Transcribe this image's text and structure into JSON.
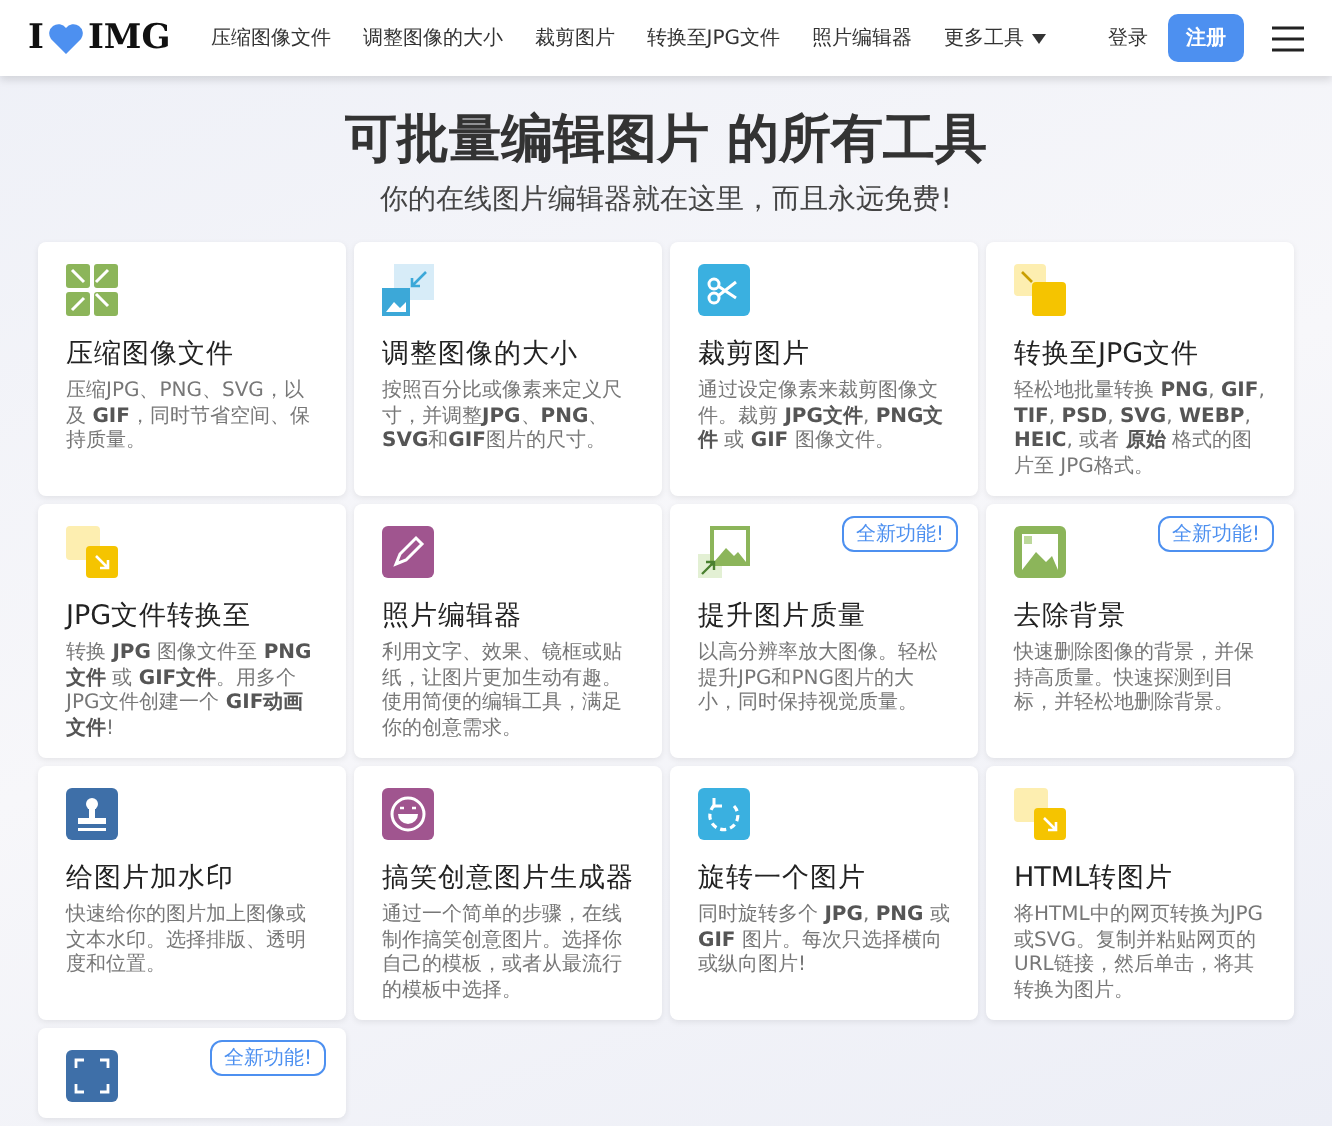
{
  "header": {
    "logo_left": "I",
    "logo_right": "IMG",
    "nav": [
      {
        "label": "压缩图像文件",
        "dropdown": false
      },
      {
        "label": "调整图像的大小",
        "dropdown": false
      },
      {
        "label": "裁剪图片",
        "dropdown": false
      },
      {
        "label": "转换至JPG文件",
        "dropdown": false
      },
      {
        "label": "照片编辑器",
        "dropdown": false
      },
      {
        "label": "更多工具",
        "dropdown": true
      }
    ],
    "login": "登录",
    "signup": "注册"
  },
  "hero": {
    "title": "可批量编辑图片 的所有工具",
    "subtitle": "你的在线图片编辑器就在这里，而且永远免费!"
  },
  "tools": [
    {
      "title": "压缩图像文件",
      "description": "压缩JPG、PNG、SVG，以及 **GIF**，同时节省空间、保持质量。"
    },
    {
      "title": "调整图像的大小",
      "description": "按照百分比或像素来定义尺寸，并调整**JPG**、**PNG**、**SVG**和**GIF**图片的尺寸。"
    },
    {
      "title": "裁剪图片",
      "description": "通过设定像素来裁剪图像文件。裁剪 **JPG文件**, **PNG文件** 或 **GIF** 图像文件。"
    },
    {
      "title": "转换至JPG文件",
      "description": "轻松地批量转换 **PNG**, **GIF**, **TIF**, **PSD**, **SVG**, **WEBP**, **HEIC**, 或者 **原始** 格式的图片至 JPG格式。"
    },
    {
      "title": "JPG文件转换至",
      "description": "转换 **JPG** 图像文件至 **PNG文件** 或 **GIF文件**。用多个JPG文件创建一个 **GIF动画文件**!"
    },
    {
      "title": "照片编辑器",
      "description": "利用文字、效果、镜框或贴纸，让图片更加生动有趣。使用简便的编辑工具，满足你的创意需求。"
    },
    {
      "title": "提升图片质量",
      "description": "以高分辨率放大图像。轻松提升JPG和PNG图片的大小，同时保持视觉质量。",
      "badge": "全新功能!"
    },
    {
      "title": "去除背景",
      "description": "快速删除图像的背景，并保持高质量。快速探测到目标，并轻松地删除背景。",
      "badge": "全新功能!"
    },
    {
      "title": "给图片加水印",
      "description": "快速给你的图片加上图像或文本水印。选择排版、透明度和位置。"
    },
    {
      "title": "搞笑创意图片生成器",
      "description": "通过一个简单的步骤，在线制作搞笑创意图片。选择你自己的模板，或者从最流行的模板中选择。"
    },
    {
      "title": "旋转一个图片",
      "description": "同时旋转多个 **JPG**, **PNG** 或 **GIF** 图片。每次只选择横向或纵向图片!"
    },
    {
      "title": "HTML转图片",
      "description": "将HTML中的网页转换为JPG或SVG。复制并粘贴网页的URL链接，然后单击，将其转换为图片。"
    },
    {
      "badge": "全新功能!"
    }
  ]
}
